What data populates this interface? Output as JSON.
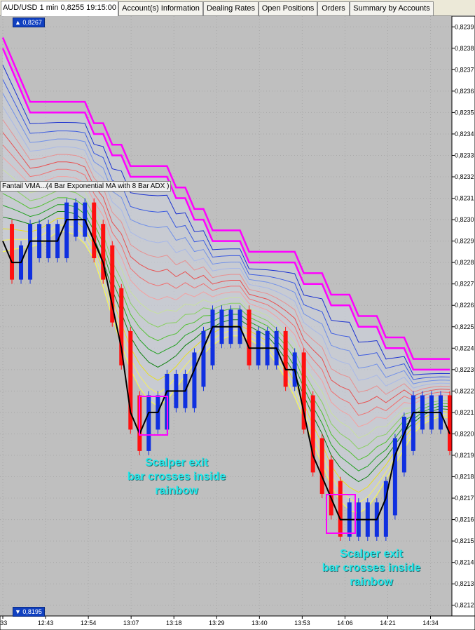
{
  "tabs": [
    {
      "label": "AUD/USD 1 min 0,8255 19:15:00",
      "active": true
    },
    {
      "label": "Account(s) Information",
      "active": false
    },
    {
      "label": "Dealing Rates",
      "active": false
    },
    {
      "label": "Open Positions",
      "active": false
    },
    {
      "label": "Orders",
      "active": false
    },
    {
      "label": "Summary by Accounts",
      "active": false
    }
  ],
  "indicator_label": "Fantail VMA...(4 Bar Exponential MA with 8 Bar ADX )",
  "price_flags": {
    "top": "▲ 0,8267",
    "bottom": "▼ 0,8195"
  },
  "annotations": [
    {
      "lines": [
        "Scalper exit",
        "bar crosses inside",
        "rainbow"
      ]
    },
    {
      "lines": [
        "Scalper exit",
        "bar crosses inside",
        "rainbow"
      ]
    }
  ],
  "colors": {
    "background": "#bfbfbf",
    "up_bar": "#1030e0",
    "down_bar": "#ff1010",
    "price_line": "#000000",
    "top_ribbon": "#ff00ff",
    "box": "#ff00ff",
    "annotation": "#23e8ea"
  },
  "chart_data": {
    "type": "line",
    "title": "",
    "symbol": "AUD/USD",
    "timeframe": "1 min",
    "ylim": [
      0.82115,
      0.82395
    ],
    "y_ticks": [
      "0,8239",
      "0,8238",
      "0,8237",
      "0,8236",
      "0,8235",
      "0,8234",
      "0,8233",
      "0,8232",
      "0,8231",
      "0,8230",
      "0,8229",
      "0,8228",
      "0,8227",
      "0,8226",
      "0,8225",
      "0,8224",
      "0,8223",
      "0,8222",
      "0,8221",
      "0,8220",
      "0,8219",
      "0,8218",
      "0,8217",
      "0,8216",
      "0,8215",
      "0,8214",
      "0,8213",
      "0,8212"
    ],
    "x_ticks": [
      ":33",
      "12:43",
      "12:54",
      "13:07",
      "13:18",
      "13:29",
      "13:40",
      "13:53",
      "14:06",
      "14:21",
      "14:34"
    ],
    "grid": true,
    "series": [
      {
        "values": [
          0.8229,
          0.8228,
          0.8228,
          0.8229,
          0.8229,
          0.8229,
          0.8229,
          0.823,
          0.823,
          0.823,
          0.8229,
          0.8228,
          0.8226,
          0.8224,
          0.8221,
          0.822,
          0.8221,
          0.8221,
          0.8222,
          0.8222,
          0.8222,
          0.8223,
          0.8224,
          0.8225,
          0.8225,
          0.8225,
          0.8225,
          0.8224,
          0.8224,
          0.8224,
          0.8224,
          0.8223,
          0.8223,
          0.8221,
          0.8219,
          0.8218,
          0.8217,
          0.8216,
          0.8216,
          0.8216,
          0.8216,
          0.8216,
          0.8217,
          0.8219,
          0.822,
          0.8221,
          0.8221,
          0.8221,
          0.8221,
          0.822
        ]
      },
      {
        "values": [
          0.8238,
          0.8237,
          0.8236,
          0.8235,
          0.8235,
          0.8235,
          0.8235,
          0.8235,
          0.8235,
          0.8235,
          0.8234,
          0.8234,
          0.8233,
          0.8233,
          0.8232,
          0.8232,
          0.8232,
          0.8232,
          0.8232,
          0.8231,
          0.8231,
          0.823,
          0.823,
          0.8229,
          0.8229,
          0.8229,
          0.8229,
          0.8228,
          0.8228,
          0.8228,
          0.8228,
          0.8228,
          0.8228,
          0.8227,
          0.8227,
          0.8227,
          0.8226,
          0.8226,
          0.8226,
          0.8225,
          0.8225,
          0.8225,
          0.8224,
          0.8224,
          0.8224,
          0.8223,
          0.8223,
          0.8223,
          0.8223,
          0.8223
        ]
      }
    ]
  }
}
